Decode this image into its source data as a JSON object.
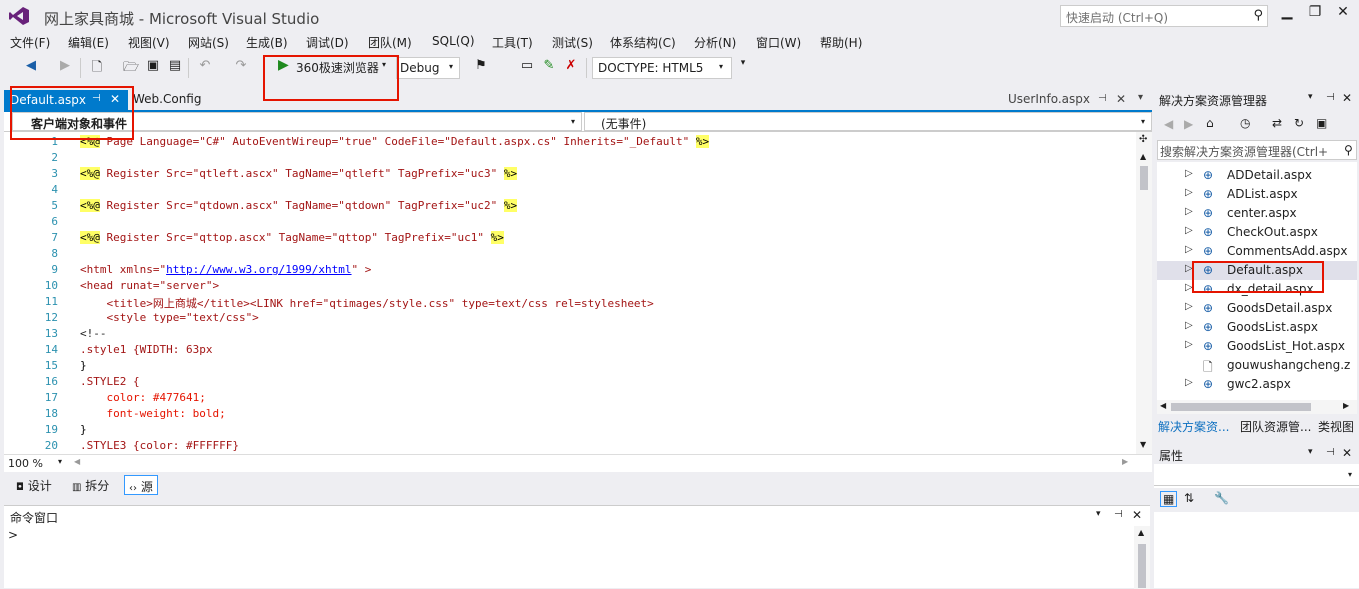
{
  "title": {
    "app": "网上家具商城 - Microsoft Visual Studio"
  },
  "quick_launch": {
    "placeholder": "快速启动 (Ctrl+Q)"
  },
  "menu": [
    "文件(F)",
    "编辑(E)",
    "视图(V)",
    "网站(S)",
    "生成(B)",
    "调试(D)",
    "团队(M)",
    "SQL(Q)",
    "工具(T)",
    "测试(S)",
    "体系结构(C)",
    "分析(N)",
    "窗口(W)",
    "帮助(H)"
  ],
  "toolbar": {
    "run_label": "360极速浏览器",
    "config": "Debug",
    "doctype": "DOCTYPE:  HTML5"
  },
  "tabs": {
    "active": "Default.aspx",
    "second": "Web.Config",
    "right": "UserInfo.aspx"
  },
  "navbar": {
    "left": "客户端对象和事件",
    "right": "(无事件)"
  },
  "code_lines": [
    {
      "n": "1"
    },
    {
      "n": "2"
    },
    {
      "n": "3"
    },
    {
      "n": "4"
    },
    {
      "n": "5"
    },
    {
      "n": "6"
    },
    {
      "n": "7"
    },
    {
      "n": "8"
    },
    {
      "n": "9"
    },
    {
      "n": "10"
    },
    {
      "n": "11"
    },
    {
      "n": "12"
    },
    {
      "n": "13"
    },
    {
      "n": "14"
    },
    {
      "n": "15"
    },
    {
      "n": "16"
    },
    {
      "n": "17"
    },
    {
      "n": "18"
    },
    {
      "n": "19"
    },
    {
      "n": "20"
    }
  ],
  "code": {
    "l1a": "<%@",
    "l1b": " Page Language=\"C#\" AutoEventWireup=\"true\" CodeFile=\"Default.aspx.cs\" Inherits=\"_Default\" ",
    "l1c": "%>",
    "l3a": "<%@",
    "l3b": " Register Src=\"qtleft.ascx\" TagName=\"qtleft\" TagPrefix=\"uc3\" ",
    "l3c": "%>",
    "l5a": "<%@",
    "l5b": " Register Src=\"qtdown.ascx\" TagName=\"qtdown\" TagPrefix=\"uc2\" ",
    "l5c": "%>",
    "l7a": "<%@",
    "l7b": " Register Src=\"qttop.ascx\" TagName=\"qttop\" TagPrefix=\"uc1\" ",
    "l7c": "%>",
    "l9a": "<html xmlns=\"",
    "l9url": "http://www.w3.org/1999/xhtml",
    "l9b": "\" >",
    "l10": "<head runat=\"server\">",
    "l11": "    <title>网上商城</title><LINK href=\"qtimages/style.css\" type=text/css rel=stylesheet>",
    "l12": "    <style type=\"text/css\">",
    "l13": "<!--",
    "l14": ".style1 {WIDTH: 63px",
    "l15": "}",
    "l16": ".STYLE2 {",
    "l17": "    color: #477641;",
    "l18": "    font-weight: bold;",
    "l19": "}",
    "l20": ".STYLE3 {color: #FFFFFF}"
  },
  "zoom": "100 %",
  "design_buttons": {
    "design": "设计",
    "split": "拆分",
    "source": "源"
  },
  "command_window": {
    "title": "命令窗口",
    "prompt": ">"
  },
  "solution_explorer": {
    "title": "解决方案资源管理器",
    "search_placeholder": "搜索解决方案资源管理器(Ctrl+",
    "items": [
      "ADDetail.aspx",
      "ADList.aspx",
      "center.aspx",
      "CheckOut.aspx",
      "CommentsAdd.aspx",
      "Default.aspx",
      "dx_detail.aspx",
      "GoodsDetail.aspx",
      "GoodsList.aspx",
      "GoodsList_Hot.aspx",
      "gouwushangcheng.z",
      "gwc2.aspx"
    ],
    "selected_index": 5,
    "tabs": [
      "解决方案资...",
      "团队资源管...",
      "类视图"
    ]
  },
  "properties": {
    "title": "属性"
  }
}
